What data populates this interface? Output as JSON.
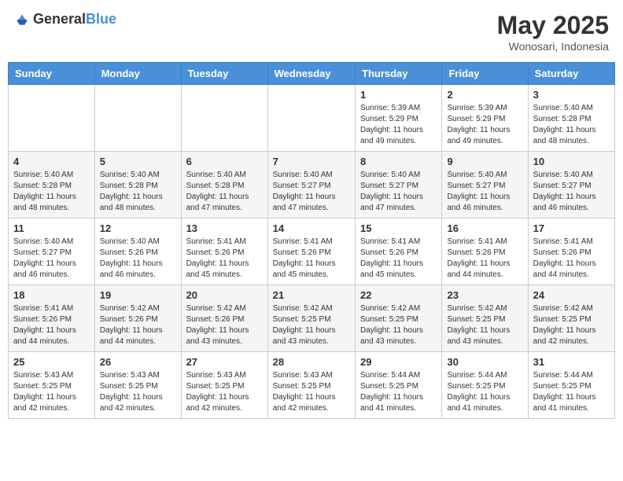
{
  "header": {
    "logo_general": "General",
    "logo_blue": "Blue",
    "month": "May 2025",
    "location": "Wonosari, Indonesia"
  },
  "days_of_week": [
    "Sunday",
    "Monday",
    "Tuesday",
    "Wednesday",
    "Thursday",
    "Friday",
    "Saturday"
  ],
  "weeks": [
    [
      {
        "day": "",
        "info": ""
      },
      {
        "day": "",
        "info": ""
      },
      {
        "day": "",
        "info": ""
      },
      {
        "day": "",
        "info": ""
      },
      {
        "day": "1",
        "info": "Sunrise: 5:39 AM\nSunset: 5:29 PM\nDaylight: 11 hours and 49 minutes."
      },
      {
        "day": "2",
        "info": "Sunrise: 5:39 AM\nSunset: 5:29 PM\nDaylight: 11 hours and 49 minutes."
      },
      {
        "day": "3",
        "info": "Sunrise: 5:40 AM\nSunset: 5:28 PM\nDaylight: 11 hours and 48 minutes."
      }
    ],
    [
      {
        "day": "4",
        "info": "Sunrise: 5:40 AM\nSunset: 5:28 PM\nDaylight: 11 hours and 48 minutes."
      },
      {
        "day": "5",
        "info": "Sunrise: 5:40 AM\nSunset: 5:28 PM\nDaylight: 11 hours and 48 minutes."
      },
      {
        "day": "6",
        "info": "Sunrise: 5:40 AM\nSunset: 5:28 PM\nDaylight: 11 hours and 47 minutes."
      },
      {
        "day": "7",
        "info": "Sunrise: 5:40 AM\nSunset: 5:27 PM\nDaylight: 11 hours and 47 minutes."
      },
      {
        "day": "8",
        "info": "Sunrise: 5:40 AM\nSunset: 5:27 PM\nDaylight: 11 hours and 47 minutes."
      },
      {
        "day": "9",
        "info": "Sunrise: 5:40 AM\nSunset: 5:27 PM\nDaylight: 11 hours and 46 minutes."
      },
      {
        "day": "10",
        "info": "Sunrise: 5:40 AM\nSunset: 5:27 PM\nDaylight: 11 hours and 46 minutes."
      }
    ],
    [
      {
        "day": "11",
        "info": "Sunrise: 5:40 AM\nSunset: 5:27 PM\nDaylight: 11 hours and 46 minutes."
      },
      {
        "day": "12",
        "info": "Sunrise: 5:40 AM\nSunset: 5:26 PM\nDaylight: 11 hours and 46 minutes."
      },
      {
        "day": "13",
        "info": "Sunrise: 5:41 AM\nSunset: 5:26 PM\nDaylight: 11 hours and 45 minutes."
      },
      {
        "day": "14",
        "info": "Sunrise: 5:41 AM\nSunset: 5:26 PM\nDaylight: 11 hours and 45 minutes."
      },
      {
        "day": "15",
        "info": "Sunrise: 5:41 AM\nSunset: 5:26 PM\nDaylight: 11 hours and 45 minutes."
      },
      {
        "day": "16",
        "info": "Sunrise: 5:41 AM\nSunset: 5:26 PM\nDaylight: 11 hours and 44 minutes."
      },
      {
        "day": "17",
        "info": "Sunrise: 5:41 AM\nSunset: 5:26 PM\nDaylight: 11 hours and 44 minutes."
      }
    ],
    [
      {
        "day": "18",
        "info": "Sunrise: 5:41 AM\nSunset: 5:26 PM\nDaylight: 11 hours and 44 minutes."
      },
      {
        "day": "19",
        "info": "Sunrise: 5:42 AM\nSunset: 5:26 PM\nDaylight: 11 hours and 44 minutes."
      },
      {
        "day": "20",
        "info": "Sunrise: 5:42 AM\nSunset: 5:26 PM\nDaylight: 11 hours and 43 minutes."
      },
      {
        "day": "21",
        "info": "Sunrise: 5:42 AM\nSunset: 5:25 PM\nDaylight: 11 hours and 43 minutes."
      },
      {
        "day": "22",
        "info": "Sunrise: 5:42 AM\nSunset: 5:25 PM\nDaylight: 11 hours and 43 minutes."
      },
      {
        "day": "23",
        "info": "Sunrise: 5:42 AM\nSunset: 5:25 PM\nDaylight: 11 hours and 43 minutes."
      },
      {
        "day": "24",
        "info": "Sunrise: 5:42 AM\nSunset: 5:25 PM\nDaylight: 11 hours and 42 minutes."
      }
    ],
    [
      {
        "day": "25",
        "info": "Sunrise: 5:43 AM\nSunset: 5:25 PM\nDaylight: 11 hours and 42 minutes."
      },
      {
        "day": "26",
        "info": "Sunrise: 5:43 AM\nSunset: 5:25 PM\nDaylight: 11 hours and 42 minutes."
      },
      {
        "day": "27",
        "info": "Sunrise: 5:43 AM\nSunset: 5:25 PM\nDaylight: 11 hours and 42 minutes."
      },
      {
        "day": "28",
        "info": "Sunrise: 5:43 AM\nSunset: 5:25 PM\nDaylight: 11 hours and 42 minutes."
      },
      {
        "day": "29",
        "info": "Sunrise: 5:44 AM\nSunset: 5:25 PM\nDaylight: 11 hours and 41 minutes."
      },
      {
        "day": "30",
        "info": "Sunrise: 5:44 AM\nSunset: 5:25 PM\nDaylight: 11 hours and 41 minutes."
      },
      {
        "day": "31",
        "info": "Sunrise: 5:44 AM\nSunset: 5:25 PM\nDaylight: 11 hours and 41 minutes."
      }
    ]
  ]
}
